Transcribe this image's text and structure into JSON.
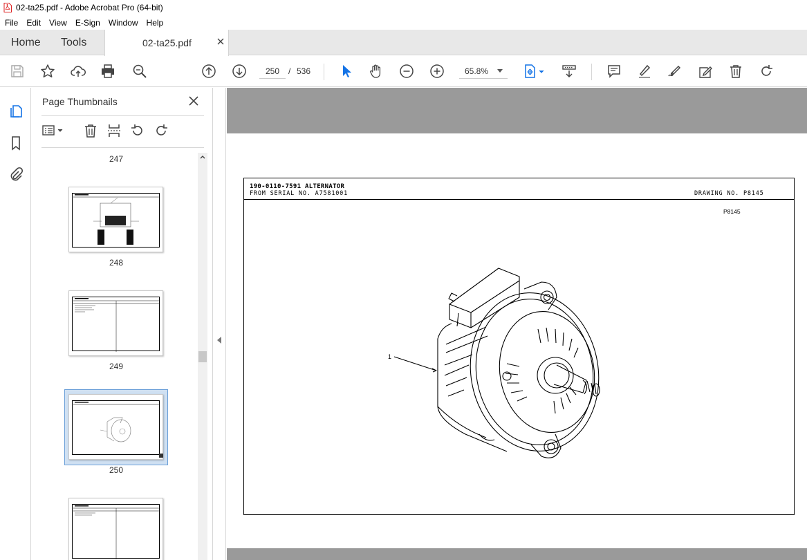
{
  "window": {
    "title": "02-ta25.pdf - Adobe Acrobat Pro (64-bit)"
  },
  "menu": [
    "File",
    "Edit",
    "View",
    "E-Sign",
    "Window",
    "Help"
  ],
  "tabs": {
    "home": "Home",
    "tools": "Tools",
    "document": "02-ta25.pdf"
  },
  "toolbar": {
    "current_page": "250",
    "page_separator": "/",
    "total_pages": "536",
    "zoom": "65.8%"
  },
  "thumbnails_panel": {
    "title": "Page Thumbnails",
    "pages": [
      {
        "number": "247"
      },
      {
        "number": "248"
      },
      {
        "number": "249"
      },
      {
        "number": "250",
        "selected": true
      }
    ]
  },
  "document": {
    "part_title": "190-0110-7591 ALTERNATOR",
    "serial_line": "FROM SERIAL NO. A7581001",
    "drawing_no": "DRAWING NO. P8145",
    "drawing_code": "P8145",
    "callout": "1"
  },
  "colors": {
    "tab_bar": "#e8e8e8",
    "selected_thumb": "#cfe0f2",
    "accent_blue": "#1473e6",
    "doc_gray": "#9a9a9a"
  }
}
